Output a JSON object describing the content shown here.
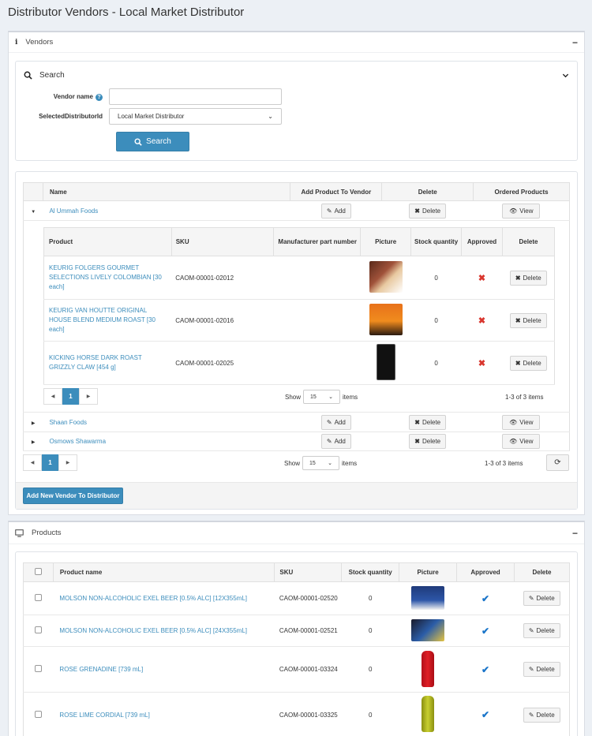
{
  "page_title": "Distributor Vendors - Local Market Distributor",
  "vendors_panel": {
    "title": "Vendors",
    "collapse": "−",
    "search": {
      "title": "Search",
      "vendor_name_label": "Vendor name",
      "vendor_name_value": "",
      "distributor_label": "SelectedDistributorId",
      "distributor_value": "Local Market Distributor",
      "search_button": "Search"
    },
    "table": {
      "headers": [
        "Name",
        "Add Product To Vendor",
        "Delete",
        "Ordered Products"
      ],
      "add_label": "Add",
      "delete_label": "Delete",
      "view_label": "View",
      "vendors": [
        "Al Ummah Foods",
        "Shaan Foods",
        "Osmows Shawarma"
      ],
      "sub_headers": [
        "Product",
        "SKU",
        "Manufacturer part number",
        "Picture",
        "Stock quantity",
        "Approved",
        "Delete"
      ],
      "sub_rows": [
        {
          "product": "KEURIG FOLGERS GOURMET SELECTIONS LIVELY COLOMBIAN [30 each]",
          "sku": "CAOM-00001-02012",
          "mpn": "",
          "stock": "0"
        },
        {
          "product": "KEURIG VAN HOUTTE ORIGINAL HOUSE BLEND MEDIUM ROAST [30 each]",
          "sku": "CAOM-00001-02016",
          "mpn": "",
          "stock": "0"
        },
        {
          "product": "KICKING HORSE DARK ROAST GRIZZLY CLAW [454 g]",
          "sku": "CAOM-00001-02025",
          "mpn": "",
          "stock": "0"
        }
      ],
      "sub_pager": {
        "page": "1",
        "show": "Show",
        "page_size": "15",
        "items": "items",
        "summary": "1-3 of 3 items"
      },
      "pager": {
        "page": "1",
        "show": "Show",
        "page_size": "15",
        "items": "items",
        "summary": "1-3 of 3 items"
      },
      "add_new_button": "Add New Vendor To Distributor"
    }
  },
  "products_panel": {
    "title": "Products",
    "collapse": "−",
    "headers": [
      "Product name",
      "SKU",
      "Stock quantity",
      "Picture",
      "Approved",
      "Delete"
    ],
    "delete_label": "Delete",
    "rows": [
      {
        "name": "MOLSON NON-ALCOHOLIC EXEL BEER [0.5% ALC] [12X355mL]",
        "sku": "CAOM-00001-02520",
        "stock": "0"
      },
      {
        "name": "MOLSON NON-ALCOHOLIC EXEL BEER [0.5% ALC] [24X355mL]",
        "sku": "CAOM-00001-02521",
        "stock": "0"
      },
      {
        "name": "ROSE GRENADINE [739 mL]",
        "sku": "CAOM-00001-03324",
        "stock": "0"
      },
      {
        "name": "ROSE LIME CORDIAL [739 mL]",
        "sku": "CAOM-00001-03325",
        "stock": "0"
      }
    ]
  },
  "colors": {
    "accent": "#3c8dbc",
    "danger": "#d9362e",
    "approved": "#1a75c9"
  },
  "icons": {
    "info": "info-icon",
    "search": "search-icon",
    "chevron": "chevron-down-icon",
    "pencil": "pencil-icon",
    "x": "x-icon",
    "eye": "eye-icon",
    "refresh": "refresh-icon",
    "monitor": "monitor-icon",
    "check": "checkmark-icon"
  }
}
